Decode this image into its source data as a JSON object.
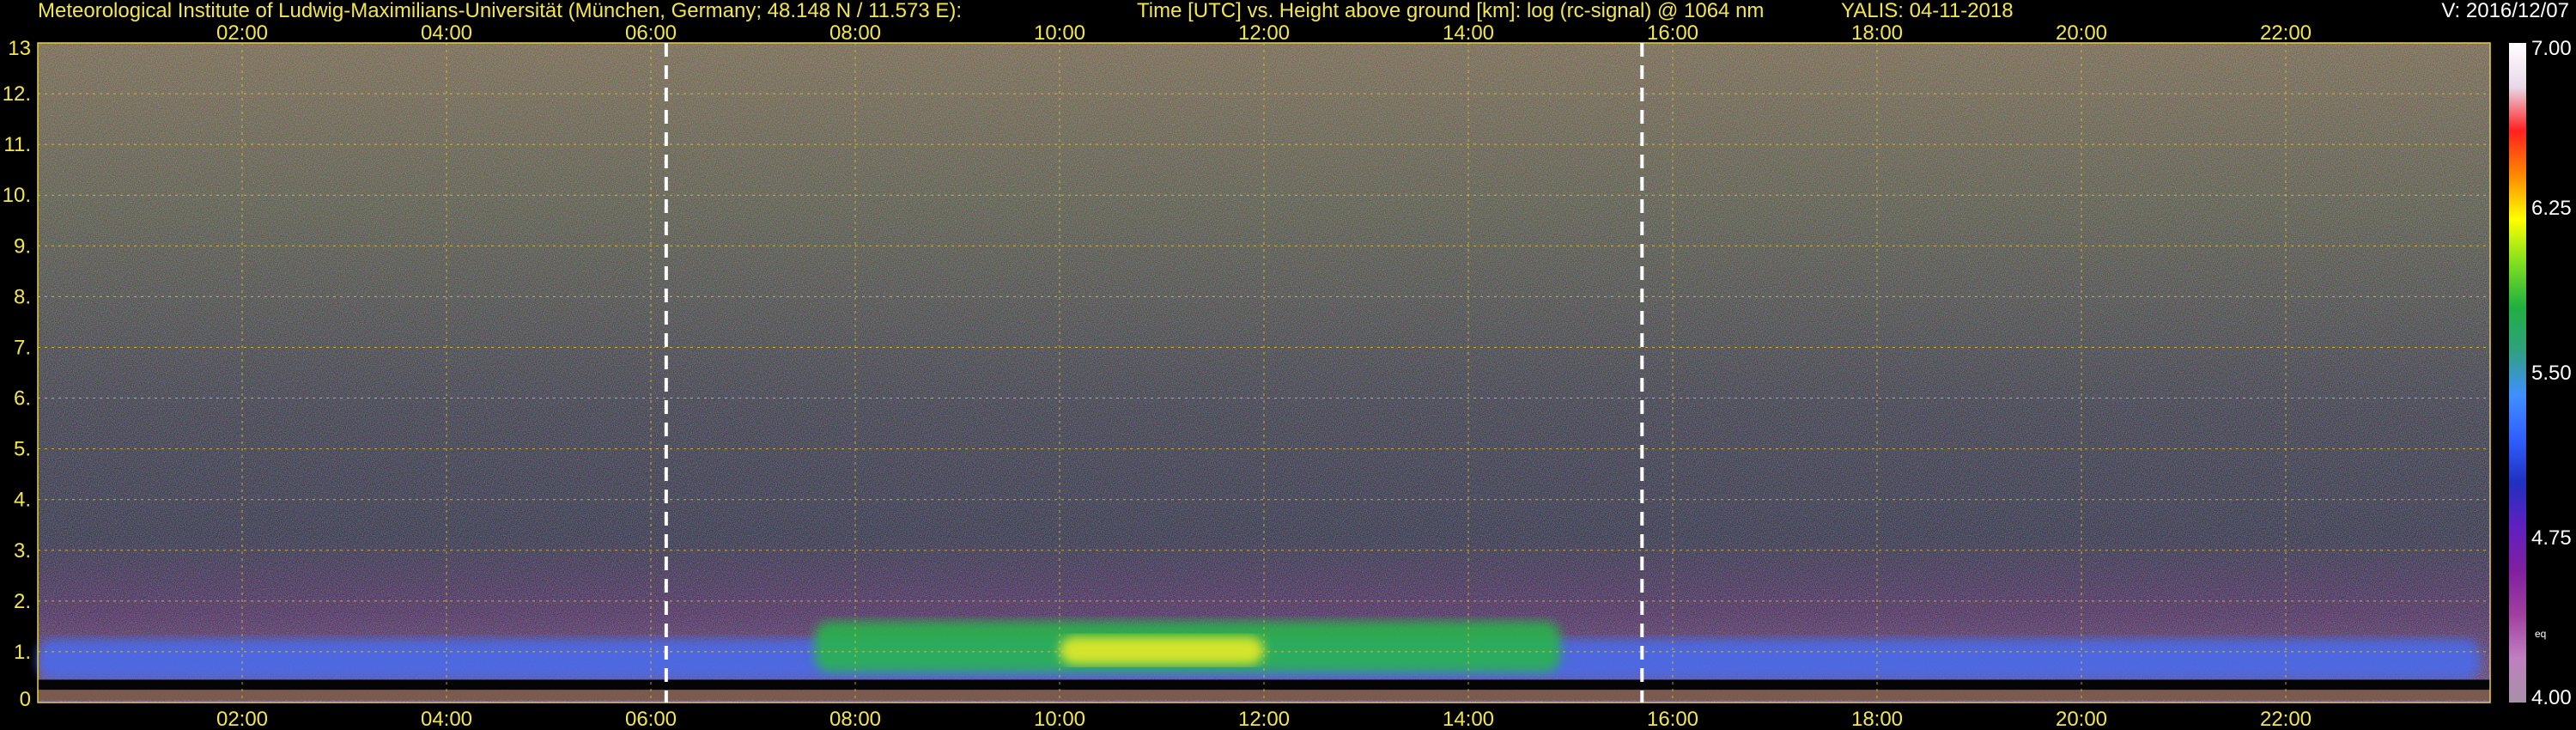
{
  "header": {
    "institute": "Meteorological Institute of Ludwig-Maximilians-Universität (München, Germany; 48.148 N / 11.573 E):",
    "title": "Time [UTC] vs. Height above ground [km]: log (rc-signal) @ 1064 nm",
    "instrument_date": "YALIS: 04-11-2018",
    "version": "V: 2016/12/07"
  },
  "chart_data": {
    "type": "heatmap",
    "title": "Time [UTC] vs. Height above ground [km]: log (rc-signal) @ 1064 nm",
    "x_tick_labels": [
      "02:00",
      "04:00",
      "06:00",
      "08:00",
      "10:00",
      "12:00",
      "14:00",
      "16:00",
      "18:00",
      "20:00",
      "22:00"
    ],
    "x_tick_hours": [
      2,
      4,
      6,
      8,
      10,
      12,
      14,
      16,
      18,
      20,
      22
    ],
    "xlim_hours": [
      0,
      24
    ],
    "y_tick_labels": [
      "0",
      "1.",
      "2.",
      "3.",
      "4.",
      "5.",
      "6.",
      "7.",
      "8.",
      "9.",
      "10.",
      "11.",
      "12.",
      "13"
    ],
    "y_ticks": [
      0,
      1,
      2,
      3,
      4,
      5,
      6,
      7,
      8,
      9,
      10,
      11,
      12,
      13
    ],
    "ylim_km": [
      0,
      13
    ],
    "grid": true,
    "marker_lines_hours": [
      6.15,
      15.7
    ],
    "colorbar": {
      "labels": [
        "7.00",
        "6.25",
        "5.50",
        "4.75",
        "4.00"
      ],
      "values": [
        7.0,
        6.25,
        5.5,
        4.75,
        4.0
      ],
      "unit": "eq",
      "colors": [
        "#ffffff",
        "#e8d8e8",
        "#ff2020",
        "#ff8800",
        "#ffff00",
        "#80e020",
        "#20b040",
        "#30a080",
        "#4090ff",
        "#3060ff",
        "#2030c0",
        "#6020c0",
        "#8020a0",
        "#a040a0",
        "#c080c0",
        "#a890a8"
      ]
    },
    "features": [
      {
        "type": "aerosol-layer",
        "start_hour": 0.0,
        "end_hour": 23.9,
        "base_km": 0.45,
        "top_km": 1.25
      },
      {
        "type": "enhanced-layer",
        "start_hour": 7.6,
        "end_hour": 14.9,
        "base_km": 0.6,
        "top_km": 1.6
      },
      {
        "type": "core",
        "start_hour": 10.0,
        "end_hour": 12.0,
        "base_km": 0.75,
        "top_km": 1.3
      }
    ]
  }
}
